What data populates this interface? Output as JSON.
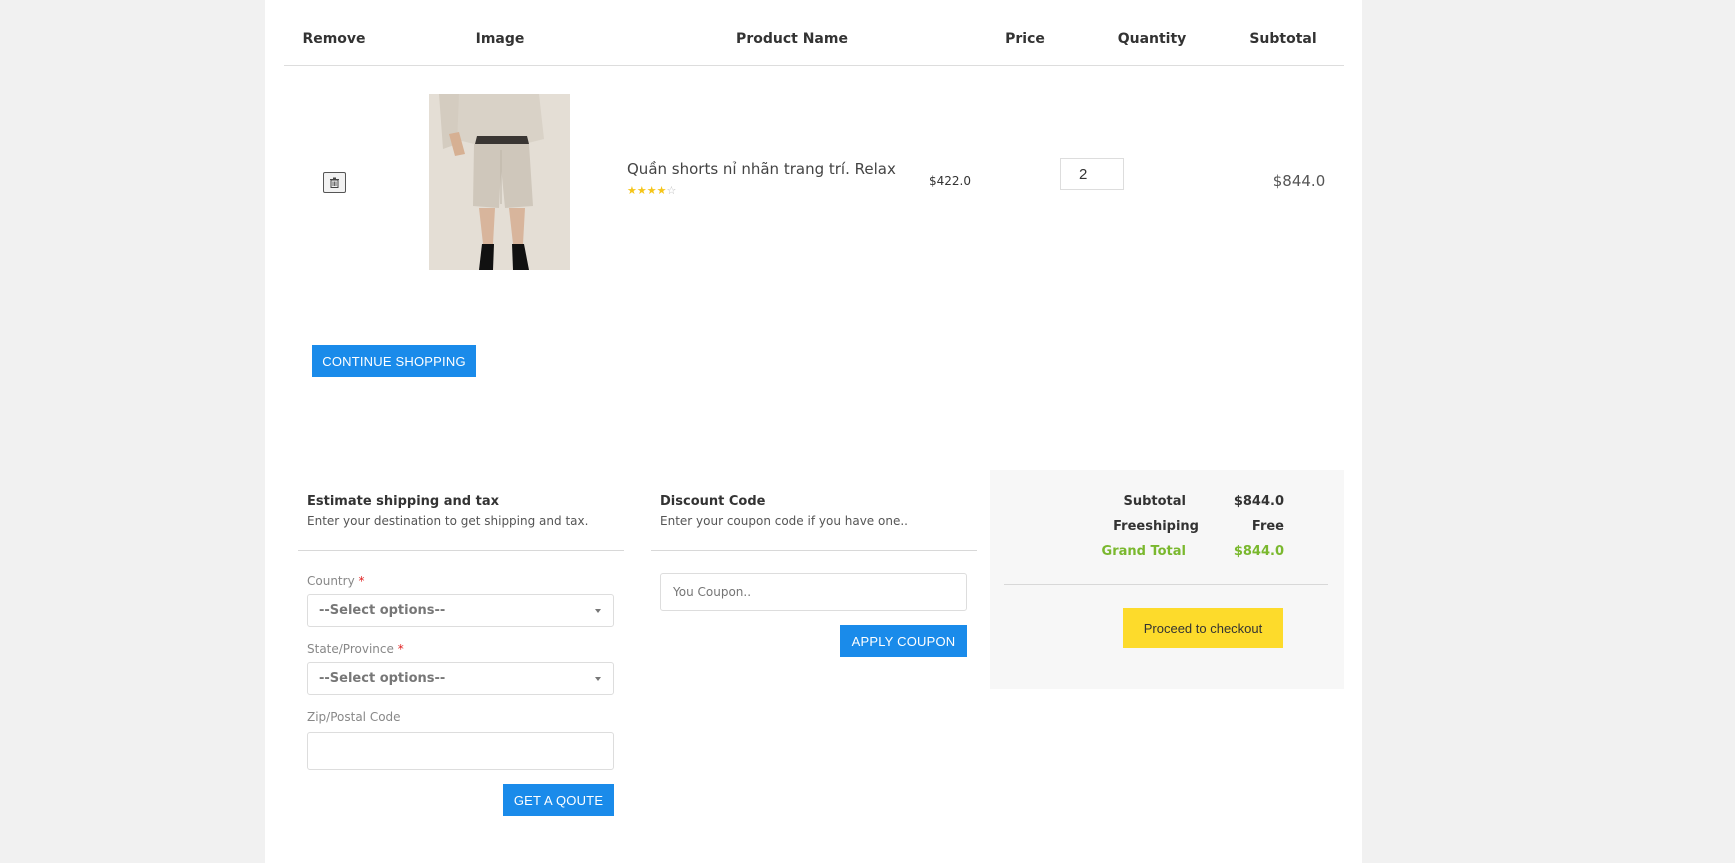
{
  "table": {
    "headers": {
      "remove": "Remove",
      "image": "Image",
      "product_name": "Product Name",
      "price": "Price",
      "quantity": "Quantity",
      "subtotal": "Subtotal"
    },
    "rows": [
      {
        "product_name": "Quần shorts nỉ nhãn trang trí. Relax",
        "rating": 4,
        "rating_max": 5,
        "price": "$422.0",
        "quantity": "2",
        "subtotal": "$844.0",
        "remove_icon": "trash-icon"
      }
    ]
  },
  "buttons": {
    "continue_shopping": "CONTINUE SHOPPING",
    "get_quote": "GET A QOUTE",
    "apply_coupon": "APPLY COUPON",
    "checkout": "Proceed to checkout"
  },
  "shipping": {
    "title": "Estimate shipping and tax",
    "subtitle": "Enter your destination to get shipping and tax.",
    "country_label": "Country",
    "state_label": "State/Province",
    "zip_label": "Zip/Postal Code",
    "required_mark": "*",
    "select_placeholder": "--Select options--"
  },
  "discount": {
    "title": "Discount Code",
    "subtitle": "Enter your coupon code if you have one..",
    "placeholder": "You Coupon.."
  },
  "totals": {
    "subtotal_label": "Subtotal",
    "subtotal_value": "$844.0",
    "shipping_label": "Freeshiping",
    "shipping_value": "Free",
    "grand_total_label": "Grand Total",
    "grand_total_value": "$844.0"
  },
  "colors": {
    "primary_button": "#1a8bea",
    "checkout_button": "#fddb2b",
    "grand_total": "#7ab82e",
    "star": "#f5c518"
  }
}
